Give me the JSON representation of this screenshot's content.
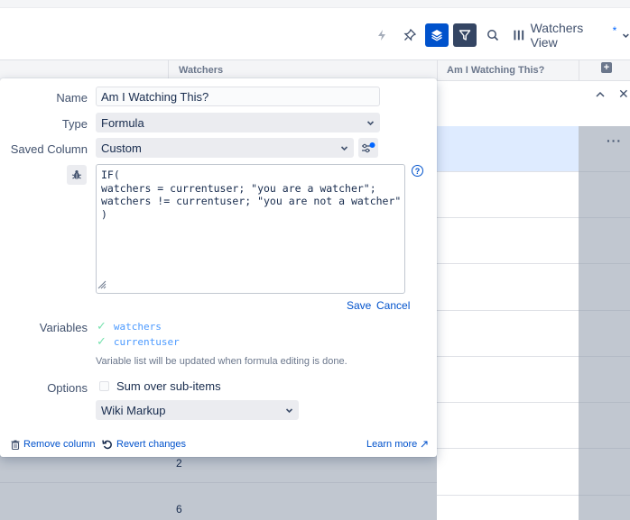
{
  "toolbar": {
    "view_name": "Watchers View",
    "view_modified_marker": "*"
  },
  "grid": {
    "columns": [
      {
        "label": "Watchers"
      },
      {
        "label": "Am I Watching This?"
      }
    ],
    "numbers": [
      "2",
      "6"
    ],
    "row_menu": "···"
  },
  "popup": {
    "name_label": "Name",
    "name_value": "Am I Watching This?",
    "type_label": "Type",
    "type_value": "Formula",
    "saved_label": "Saved Column",
    "saved_value": "Custom",
    "formula_lines": [
      "IF(",
      "watchers = currentuser; \"you are a watcher\";",
      "watchers != currentuser; \"you are not a watcher\"",
      ")"
    ],
    "save_link": "Save",
    "cancel_link": "Cancel",
    "variables_label": "Variables",
    "variables": [
      "watchers",
      "currentuser"
    ],
    "variables_hint": "Variable list will be updated when formula editing is done.",
    "options_label": "Options",
    "sum_option": "Sum over sub-items",
    "markup_value": "Wiki Markup",
    "remove_column": "Remove column",
    "revert_changes": "Revert changes",
    "learn_more": "Learn more"
  },
  "colors": {
    "accent": "#0052cc",
    "dark_button": "#344563",
    "grid_overlay": "#c1c7d0"
  }
}
